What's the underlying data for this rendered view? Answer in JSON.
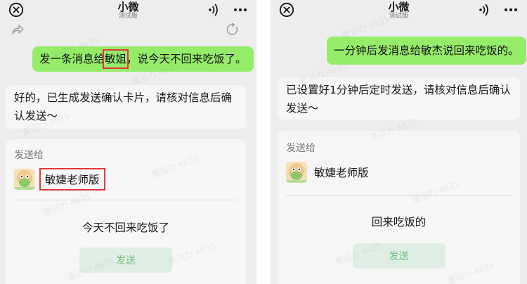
{
  "header": {
    "title": "小微",
    "subtitle": "测试版"
  },
  "watermark": "董滔力 4635",
  "left": {
    "user_message": {
      "before": "发一条消息给",
      "highlight": "敏姐",
      "after": "，说今天不回来吃饭了。"
    },
    "ai_message": "好的，已生成发送确认卡片，请核对信息后确认发送～",
    "card": {
      "label": "发送给",
      "recipient": "敏婕老师版",
      "message": "今天不回来吃饭了",
      "send": "发送"
    }
  },
  "right": {
    "user_message": "一分钟后发消息给敏杰说回来吃饭的。",
    "ai_message": "已设置好1分钟后定时发送，请核对信息后确认发送～",
    "card": {
      "label": "发送给",
      "recipient": "敏婕老师版",
      "message": "回来吃饭的",
      "send": "发送"
    }
  },
  "colors": {
    "user_bubble": "#95ec69",
    "highlight_box": "#e5343a",
    "send_button_text": "#6fbf86"
  }
}
